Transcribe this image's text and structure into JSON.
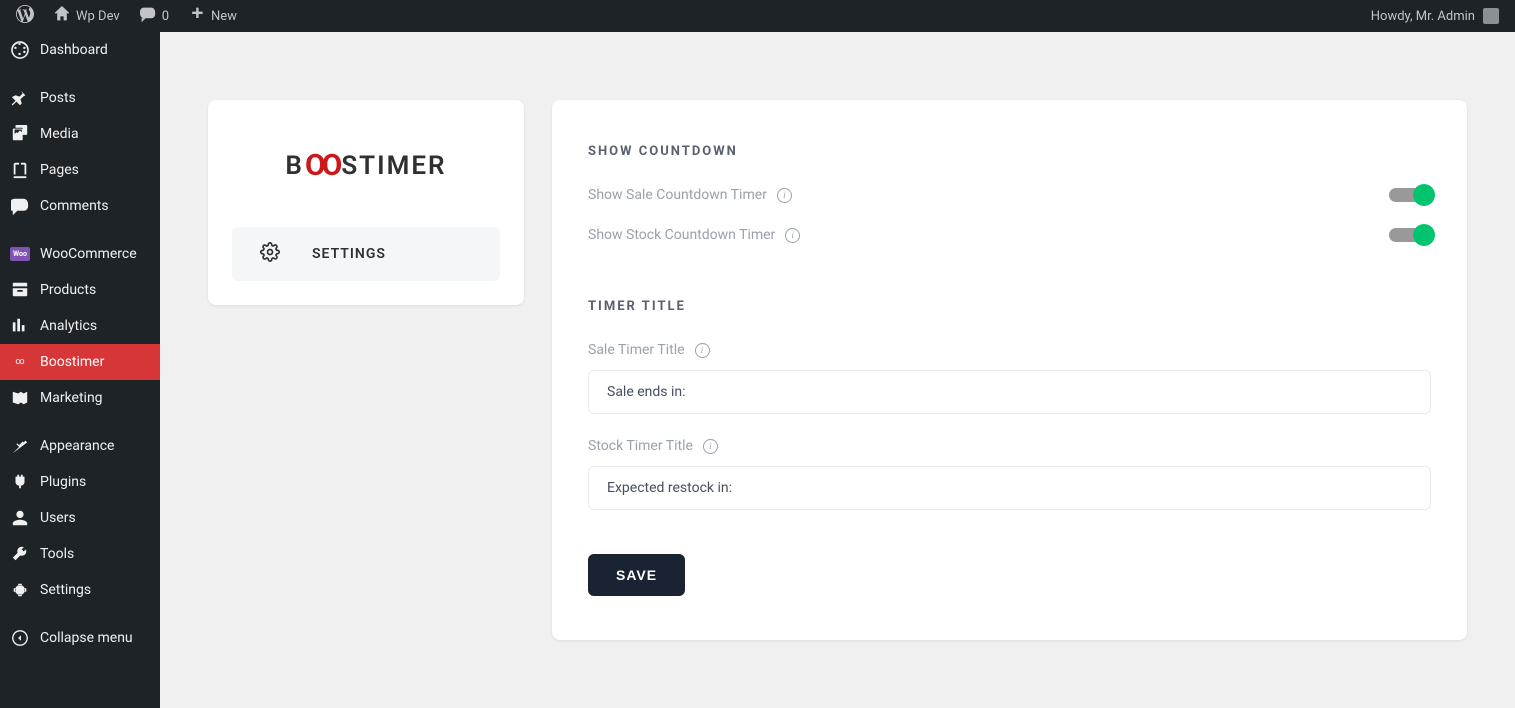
{
  "adminbar": {
    "site_name": "Wp Dev",
    "comment_count": "0",
    "new_label": "New",
    "howdy": "Howdy, Mr. Admin"
  },
  "sidebar": {
    "items": [
      {
        "label": "Dashboard"
      },
      {
        "label": "Posts"
      },
      {
        "label": "Media"
      },
      {
        "label": "Pages"
      },
      {
        "label": "Comments"
      },
      {
        "label": "WooCommerce"
      },
      {
        "label": "Products"
      },
      {
        "label": "Analytics"
      },
      {
        "label": "Boostimer"
      },
      {
        "label": "Marketing"
      },
      {
        "label": "Appearance"
      },
      {
        "label": "Plugins"
      },
      {
        "label": "Users"
      },
      {
        "label": "Tools"
      },
      {
        "label": "Settings"
      },
      {
        "label": "Collapse menu"
      }
    ]
  },
  "plugin": {
    "logo_prefix": "B",
    "logo_oo": "OO",
    "logo_suffix": "STIMER",
    "settings_label": "SETTINGS"
  },
  "settings": {
    "countdown_section": "SHOW COUNTDOWN",
    "sale_toggle_label": "Show Sale Countdown Timer",
    "stock_toggle_label": "Show Stock Countdown Timer",
    "timer_section": "TIMER TITLE",
    "sale_title_label": "Sale Timer Title",
    "sale_title_value": "Sale ends in:",
    "stock_title_label": "Stock Timer Title",
    "stock_title_value": "Expected restock in:",
    "save_label": "SAVE"
  }
}
